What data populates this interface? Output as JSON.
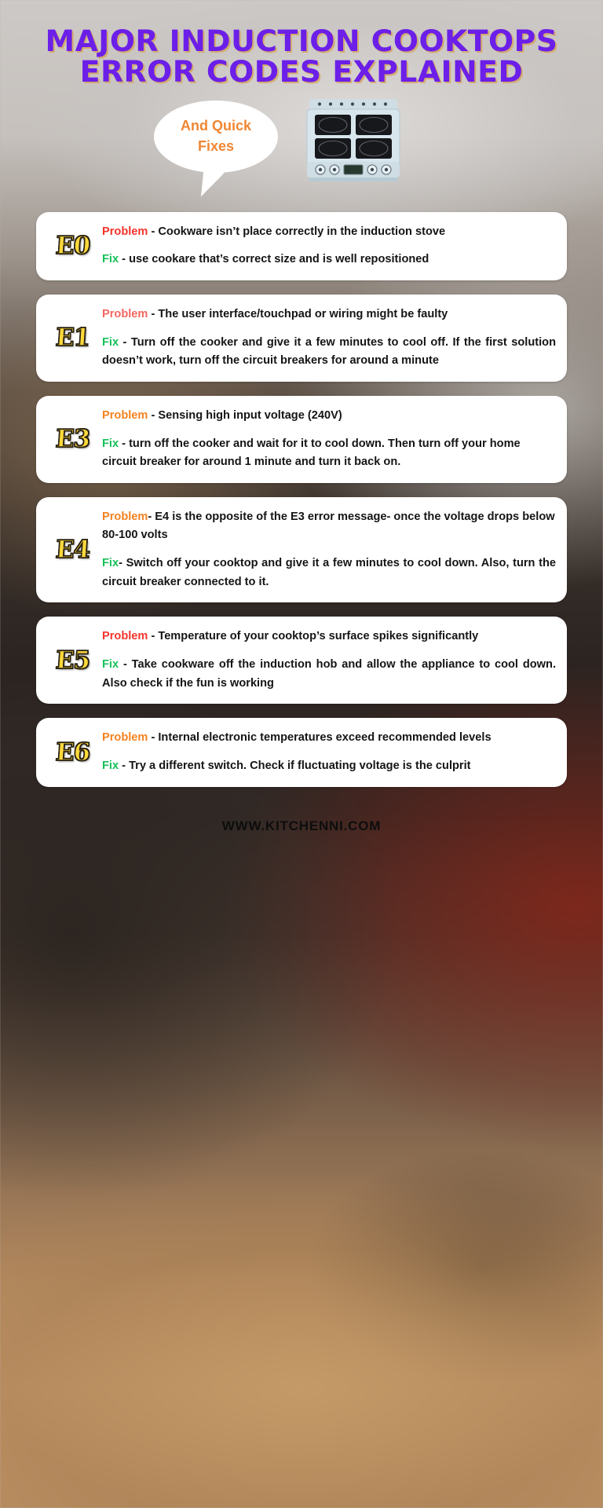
{
  "header": {
    "title_line1": "MAJOR INDUCTION COOKTOPS",
    "title_line2": "ERROR CODES EXPLAINED",
    "title_color": "#6b1fe8",
    "bubble_text": "And Quick Fixes",
    "bubble_text_color": "#f08633",
    "stove_icon": "induction-cooktop-illustration"
  },
  "colors": {
    "problem_red": "#f5342c",
    "problem_salmon": "#f4665f",
    "problem_orange": "#f5821f",
    "fix_green": "#16c05a",
    "code_yellow": "#ffd93b",
    "card_background": "#ffffff"
  },
  "cards": [
    {
      "code": "E0",
      "problem_label": "Problem",
      "problem_label_color": "#f5342c",
      "problem_text": " - Cookware isn’t place correctly in the induction stove",
      "fix_label": "Fix",
      "fix_text": " - use cookare that’s correct size and is well repositioned"
    },
    {
      "code": "E1",
      "problem_label": "Problem",
      "problem_label_color": "#f4665f",
      "problem_text": " - The user interface/touchpad or wiring might be faulty",
      "fix_label": "Fix",
      "fix_text": " - Turn off the cooker and give it a few minutes to cool off. If the first solution doesn’t work, turn off the circuit breakers for around a minute"
    },
    {
      "code": "E3",
      "problem_label": "Problem",
      "problem_label_color": "#f5821f",
      "problem_text": " - Sensing high input voltage (240V)",
      "fix_label": "Fix",
      "fix_text": " - turn off the cooker and wait for it to cool down. Then turn off your home circuit breaker for around 1 minute and turn it back on."
    },
    {
      "code": "E4",
      "problem_label": "Problem",
      "problem_label_color": "#f5821f",
      "problem_text": "- E4 is the opposite of the E3 error message- once the voltage drops below 80-100 volts",
      "fix_label": "Fix",
      "fix_text": "- Switch off your cooktop and give it a few minutes to cool down. Also, turn the circuit breaker connected to it."
    },
    {
      "code": "E5",
      "problem_label": "Problem",
      "problem_label_color": "#f5342c",
      "problem_text": " - Temperature of your cooktop’s surface spikes significantly",
      "fix_label": "Fix",
      "fix_text": " - Take cookware off the induction hob and allow the appliance to cool down. Also check if the fun is working"
    },
    {
      "code": "E6",
      "problem_label": "Problem",
      "problem_label_color": "#f5821f",
      "problem_text": " - Internal electronic temperatures exceed recommended levels",
      "fix_label": "Fix",
      "fix_text": " - Try a different switch. Check if fluctuating voltage is the culprit"
    }
  ],
  "footer": {
    "website": "WWW.KITCHENNI.COM"
  }
}
